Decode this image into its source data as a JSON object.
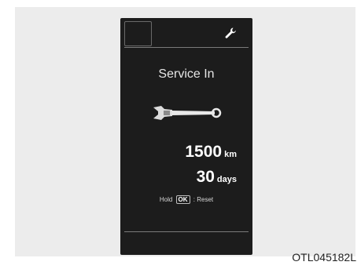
{
  "cluster": {
    "top_icon": "wrench-icon",
    "title": "Service In",
    "center_icon": "wrench-icon",
    "distance_value": "1500",
    "distance_unit": "km",
    "days_value": "30",
    "days_unit": "days",
    "hint_prefix": "Hold",
    "hint_key": "OK",
    "hint_suffix": ": Reset"
  },
  "figure": {
    "caption": "OTL045182L"
  },
  "colors": {
    "display_bg": "#1c1c1c",
    "frame_bg": "#ececec",
    "text": "#ffffff"
  }
}
